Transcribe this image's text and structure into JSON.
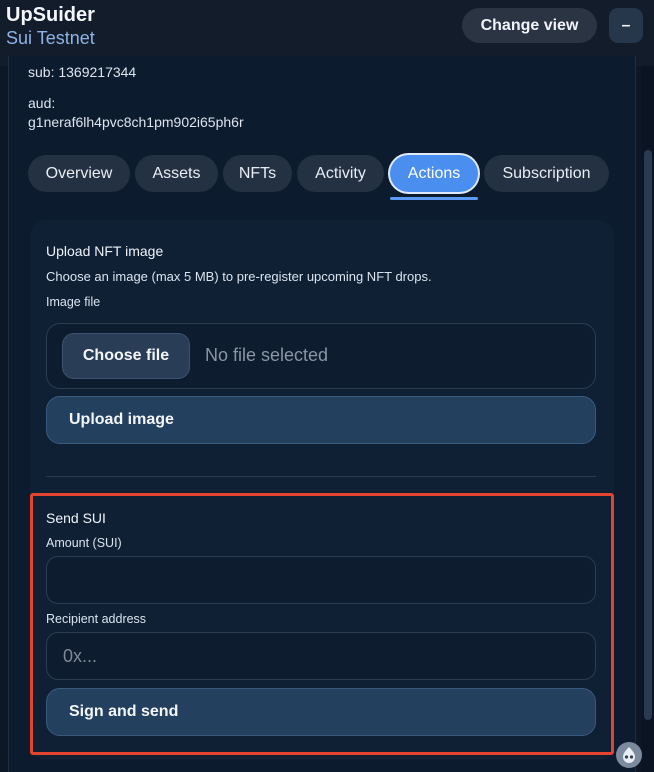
{
  "header": {
    "app_name": "UpSuider",
    "network": "Sui Testnet",
    "change_view_label": "Change view",
    "collapse_label": "–"
  },
  "account": {
    "sub": "sub: 1369217344",
    "aud_label": "aud:",
    "aud_value": "g1neraf6lh4pvc8ch1pm902i65ph6r"
  },
  "tabs": [
    {
      "label": "Overview",
      "active": false
    },
    {
      "label": "Assets",
      "active": false
    },
    {
      "label": "NFTs",
      "active": false
    },
    {
      "label": "Activity",
      "active": false
    },
    {
      "label": "Actions",
      "active": true
    },
    {
      "label": "Subscription",
      "active": false
    }
  ],
  "upload": {
    "title": "Upload NFT image",
    "description": "Choose an image (max 5 MB) to pre-register upcoming NFT drops.",
    "file_label": "Image file",
    "choose_file_label": "Choose file",
    "no_file_text": "No file selected",
    "upload_button_label": "Upload image"
  },
  "send": {
    "title": "Send SUI",
    "amount_label": "Amount (SUI)",
    "amount_value": "",
    "recipient_label": "Recipient address",
    "recipient_placeholder": "0x...",
    "submit_label": "Sign and send"
  },
  "colors": {
    "background": "#0e1726",
    "accent": "#4a8ff0",
    "highlight_border": "#e2442f"
  }
}
